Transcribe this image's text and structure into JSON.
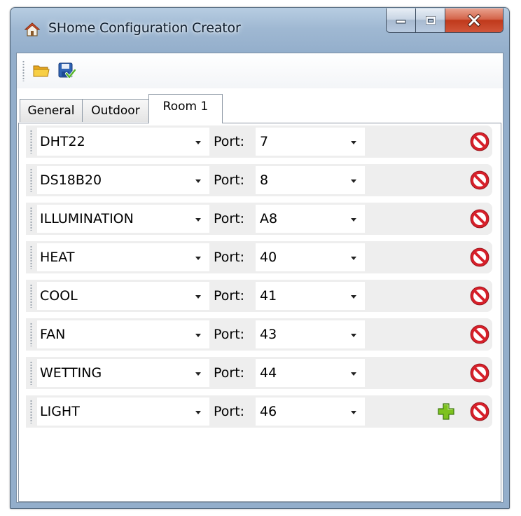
{
  "window": {
    "title": "SHome Configuration Creator",
    "app_icon": "house-icon"
  },
  "caption_buttons": {
    "minimize_icon": "minimize-icon",
    "maximize_icon": "maximize-icon",
    "close_icon": "close-icon",
    "close_color": "#c7402a"
  },
  "toolbar": {
    "buttons": [
      {
        "name": "open-button",
        "icon": "folder-open-icon"
      },
      {
        "name": "save-button",
        "icon": "save-disk-icon"
      }
    ]
  },
  "tabs": [
    {
      "label": "General",
      "active": false
    },
    {
      "label": "Outdoor",
      "active": false
    },
    {
      "label": "Room 1",
      "active": true
    }
  ],
  "port_label": "Port:",
  "rows": [
    {
      "sensor": "DHT22",
      "port": "7",
      "add": false
    },
    {
      "sensor": "DS18B20",
      "port": "8",
      "add": false
    },
    {
      "sensor": "ILLUMINATION",
      "port": "A8",
      "add": false
    },
    {
      "sensor": "HEAT",
      "port": "40",
      "add": false
    },
    {
      "sensor": "COOL",
      "port": "41",
      "add": false
    },
    {
      "sensor": "FAN",
      "port": "43",
      "add": false
    },
    {
      "sensor": "WETTING",
      "port": "44",
      "add": false
    },
    {
      "sensor": "LIGHT",
      "port": "46",
      "add": true
    }
  ],
  "icons": {
    "delete": "delete-prohibited-icon",
    "add": "add-plus-icon"
  },
  "colors": {
    "delete_red": "#d6202a",
    "add_green": "#7dc21e",
    "folder_yellow": "#f2c230",
    "save_blue": "#2f64b5"
  }
}
